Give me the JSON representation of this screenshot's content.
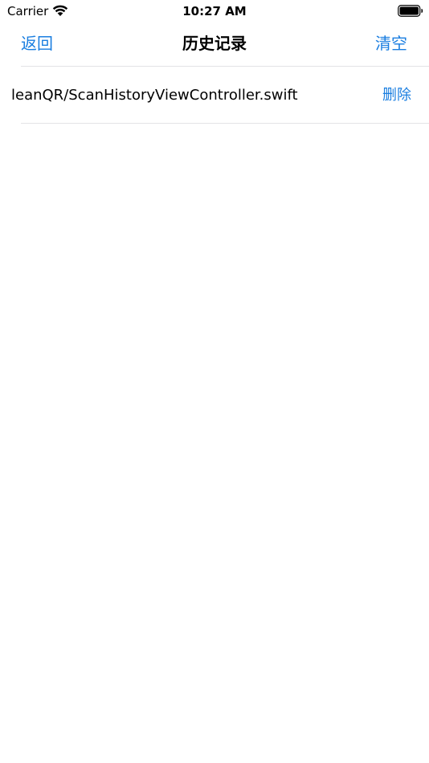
{
  "status_bar": {
    "carrier": "Carrier",
    "time": "10:27 AM",
    "icons": [
      "wifi-icon",
      "battery-icon"
    ]
  },
  "nav": {
    "back_label": "返回",
    "title": "历史记录",
    "clear_label": "清空"
  },
  "history": {
    "items": [
      {
        "text": "leanQR/ScanHistoryViewController.swift",
        "delete_label": "删除"
      }
    ]
  },
  "colors": {
    "accent": "#1a7ee0",
    "separator": "#e3e3e6",
    "background": "#ffffff"
  }
}
